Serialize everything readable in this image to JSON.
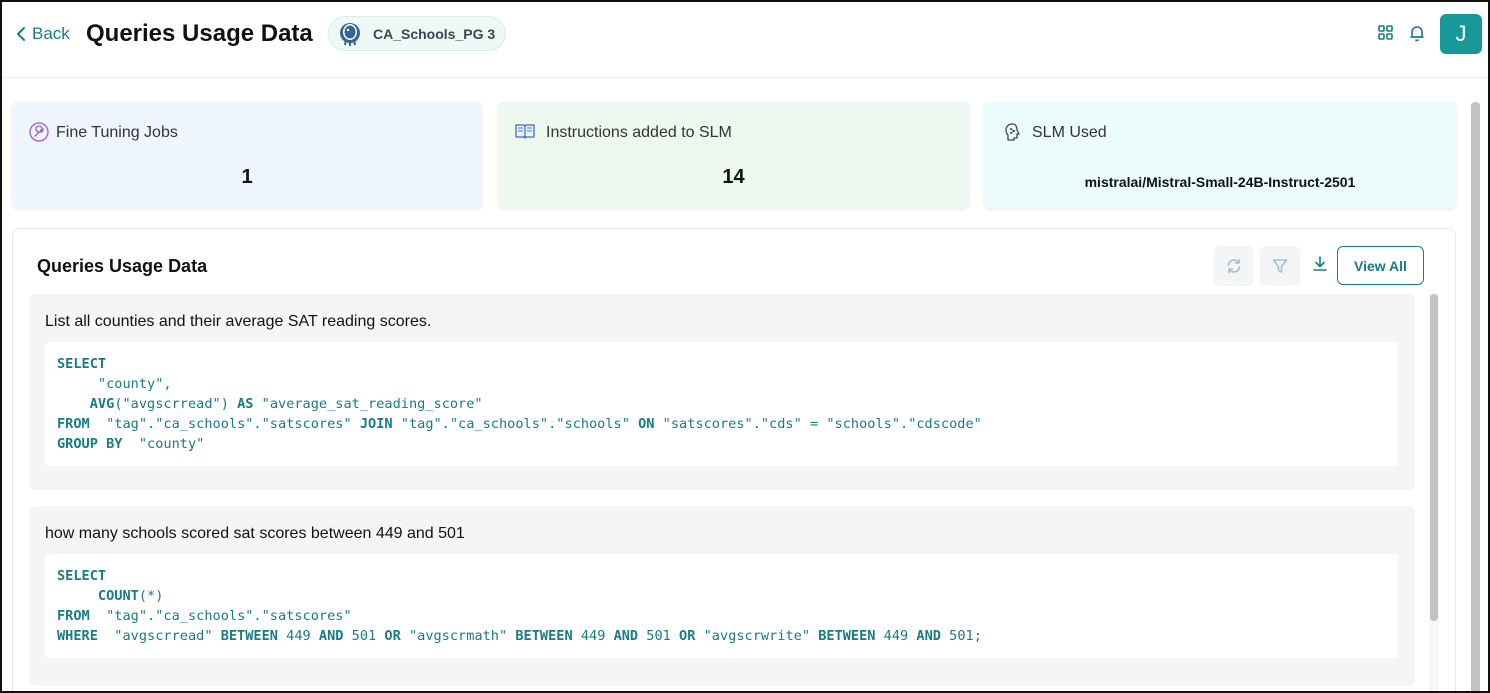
{
  "header": {
    "back_label": "Back",
    "title": "Queries Usage Data",
    "db_chip": "CA_Schools_PG 3",
    "avatar_initial": "J"
  },
  "stats": {
    "fine_tuning": {
      "label": "Fine Tuning Jobs",
      "value": "1"
    },
    "instructions": {
      "label": "Instructions added to SLM",
      "value": "14"
    },
    "slm": {
      "label": "SLM Used",
      "value": "mistralai/Mistral-Small-24B-Instruct-2501"
    }
  },
  "panel": {
    "title": "Queries Usage Data",
    "view_all_label": "View All"
  },
  "queries": [
    {
      "question": "List all counties and their average SAT reading scores.",
      "sql_lines": [
        "SELECT",
        "     \"county\",",
        "    AVG(\"avgscrread\") AS \"average_sat_reading_score\"",
        "FROM  \"tag\".\"ca_schools\".\"satscores\" JOIN \"tag\".\"ca_schools\".\"schools\" ON \"satscores\".\"cds\" = \"schools\".\"cdscode\"",
        "GROUP BY  \"county\""
      ]
    },
    {
      "question": "how many schools scored sat scores between 449 and 501",
      "sql_lines": [
        "SELECT",
        "     COUNT(*)",
        "FROM  \"tag\".\"ca_schools\".\"satscores\"",
        "WHERE  \"avgscrread\" BETWEEN 449 AND 501 OR \"avgscrmath\" BETWEEN 449 AND 501 OR \"avgscrwrite\" BETWEEN 449 AND 501;"
      ]
    }
  ],
  "colors": {
    "accent": "#187b86",
    "avatar_bg": "#17999a",
    "card_blue": "#eef5ff",
    "card_green": "#edf8f1",
    "card_cyan": "#eafcfc"
  }
}
